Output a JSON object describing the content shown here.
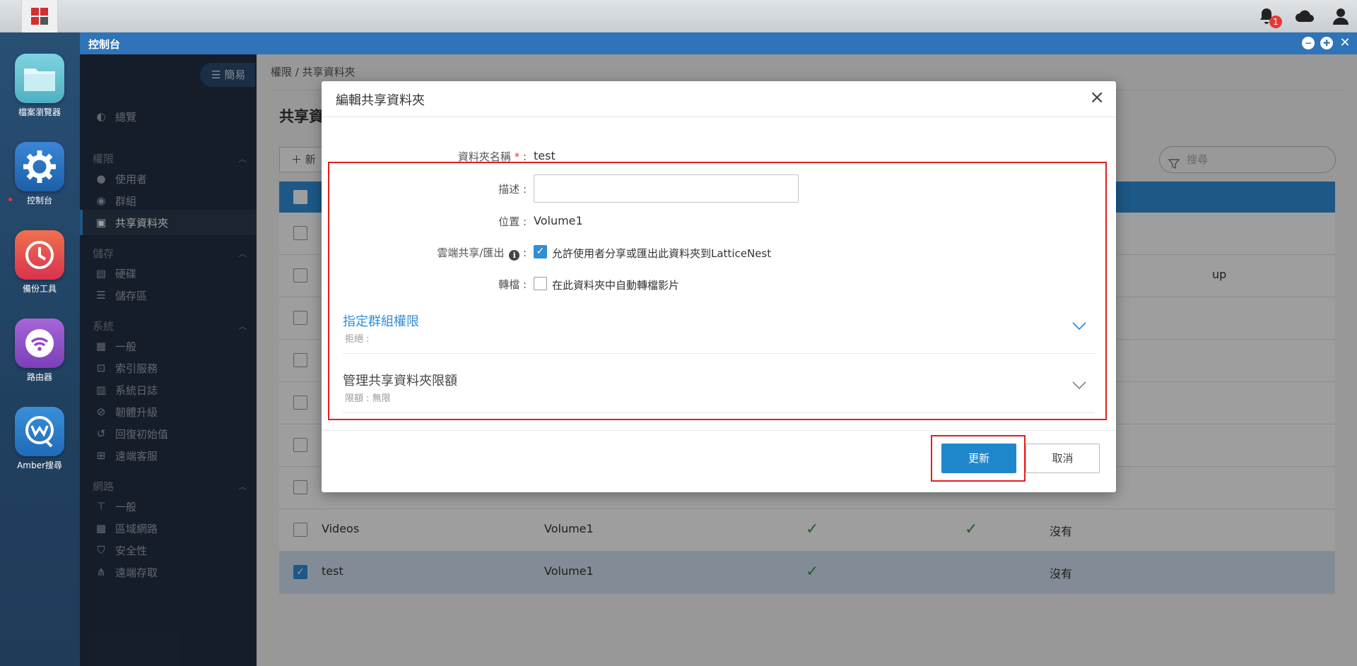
{
  "topbar": {
    "notification_count": "1"
  },
  "dock": {
    "apps": [
      {
        "label": "檔案瀏覽器"
      },
      {
        "label": "控制台"
      },
      {
        "label": "備份工具"
      },
      {
        "label": "路由器"
      },
      {
        "label": "Amber搜尋"
      }
    ]
  },
  "window": {
    "title": "控制台",
    "controls": {
      "minimize": "−",
      "maximize": "✚",
      "close": "✕"
    }
  },
  "sidebar": {
    "mode_button": "簡易",
    "overview": "總覽",
    "sections": [
      {
        "title": "權限",
        "items": [
          "使用者",
          "群組",
          "共享資料夾"
        ]
      },
      {
        "title": "儲存",
        "items": [
          "硬碟",
          "儲存區"
        ]
      },
      {
        "title": "系統",
        "items": [
          "一般",
          "索引服務",
          "系統日誌",
          "韌體升級",
          "回復初始值",
          "遠端客服"
        ]
      },
      {
        "title": "網路",
        "items": [
          "一般",
          "區域網路",
          "安全性",
          "遠端存取"
        ]
      }
    ]
  },
  "main": {
    "breadcrumb": "權限 / 共享資料夾",
    "page_title": "共享資",
    "new_button": "新",
    "search_placeholder": "搜尋",
    "partial_cell": "up",
    "rows": [
      {
        "name": "Videos",
        "location": "Volume1",
        "col3": "✓",
        "col4": "✓",
        "status": "沒有",
        "checked": false
      },
      {
        "name": "test",
        "location": "Volume1",
        "col3": "✓",
        "col4": "",
        "status": "沒有",
        "checked": true
      }
    ]
  },
  "modal": {
    "title": "編輯共享資料夾",
    "close": "×",
    "name_label": "資料夾名稱",
    "name_required": "*",
    "name_colon": ":",
    "name_value": "test",
    "desc_label": "描述 :",
    "desc_value": "",
    "location_label": "位置 :",
    "location_value": "Volume1",
    "cloud_label": "雲端共享/匯出",
    "cloud_colon": ":",
    "cloud_checkbox_label": "允許使用者分享或匯出此資料夾到LatticeNest",
    "transcode_label": "轉檔 :",
    "transcode_checkbox_label": "在此資料夾中自動轉檔影片",
    "group_section_title": "指定群組權限",
    "group_section_sub": "拒絕 :",
    "quota_section_title": "管理共享資料夾限額",
    "quota_section_sub": "限額 : 無限",
    "update_button": "更新",
    "cancel_button": "取消"
  },
  "colors": {
    "accent": "#2f8ed8",
    "highlight": "#e02020",
    "window_title": "#2f73b8"
  }
}
